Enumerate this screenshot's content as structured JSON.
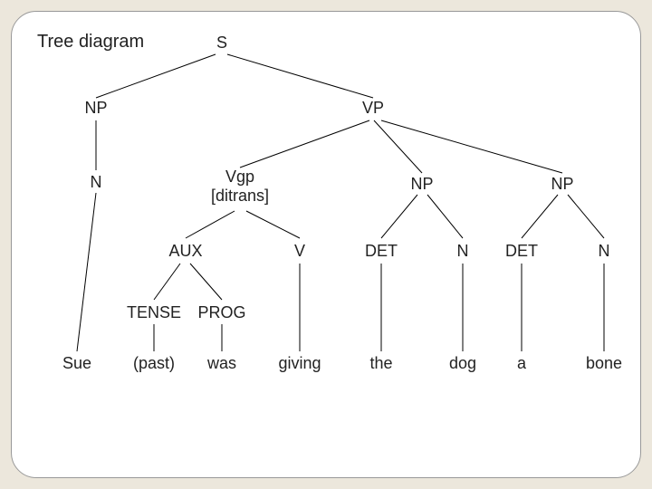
{
  "title": "Tree diagram",
  "nodes": {
    "S": "S",
    "NP_subj": "NP",
    "VP": "VP",
    "N_subj": "N",
    "Vgp": "Vgp\n[ditrans]",
    "NP_obj1": "NP",
    "NP_obj2": "NP",
    "AUX": "AUX",
    "V": "V",
    "DET1": "DET",
    "N_obj1": "N",
    "DET2": "DET",
    "N_obj2": "N",
    "TENSE": "TENSE",
    "PROG": "PROG",
    "t_sue": "Sue",
    "t_past": "(past)",
    "t_was": "was",
    "t_giving": "giving",
    "t_the": "the",
    "t_dog": "dog",
    "t_a": "a",
    "t_bone": "bone"
  },
  "chart_data": {
    "type": "tree",
    "title": "Tree diagram",
    "sentence": "Sue (past) was giving the dog a bone",
    "root": {
      "label": "S",
      "children": [
        {
          "label": "NP",
          "children": [
            {
              "label": "N",
              "children": [
                {
                  "label": "Sue"
                }
              ]
            }
          ]
        },
        {
          "label": "VP",
          "children": [
            {
              "label": "Vgp [ditrans]",
              "children": [
                {
                  "label": "AUX",
                  "children": [
                    {
                      "label": "TENSE",
                      "children": [
                        {
                          "label": "(past)"
                        }
                      ]
                    },
                    {
                      "label": "PROG",
                      "children": [
                        {
                          "label": "was"
                        }
                      ]
                    }
                  ]
                },
                {
                  "label": "V",
                  "children": [
                    {
                      "label": "giving"
                    }
                  ]
                }
              ]
            },
            {
              "label": "NP",
              "children": [
                {
                  "label": "DET",
                  "children": [
                    {
                      "label": "the"
                    }
                  ]
                },
                {
                  "label": "N",
                  "children": [
                    {
                      "label": "dog"
                    }
                  ]
                }
              ]
            },
            {
              "label": "NP",
              "children": [
                {
                  "label": "DET",
                  "children": [
                    {
                      "label": "a"
                    }
                  ]
                },
                {
                  "label": "N",
                  "children": [
                    {
                      "label": "bone"
                    }
                  ]
                }
              ]
            }
          ]
        }
      ]
    }
  }
}
